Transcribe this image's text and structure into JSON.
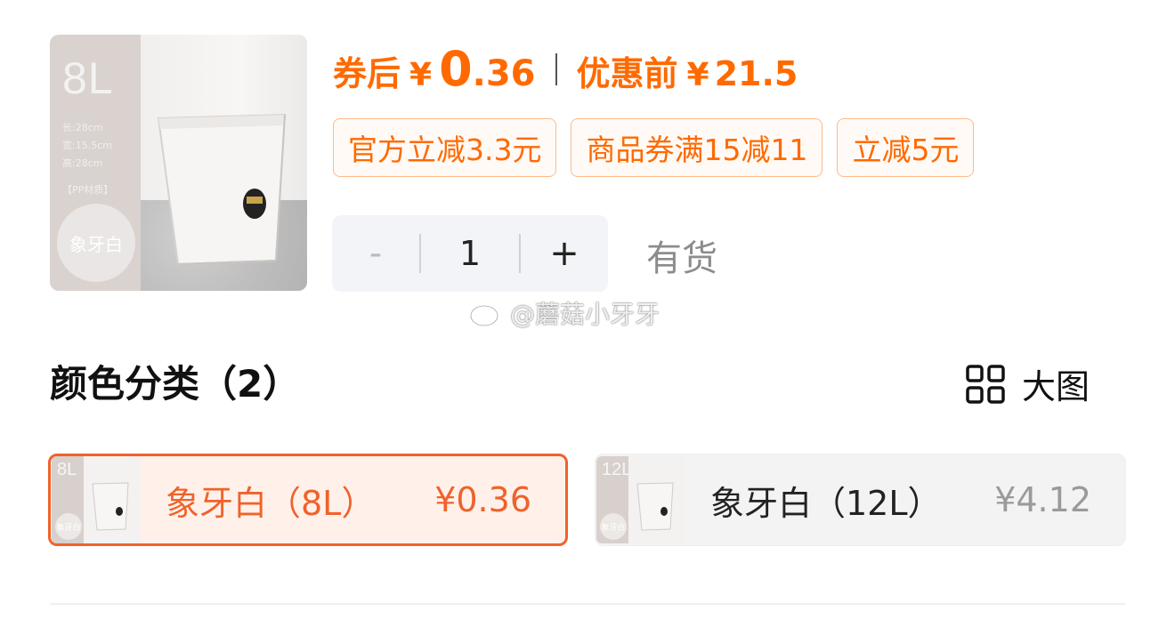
{
  "product": {
    "image_alt": "象牙白 8L 垃圾桶",
    "image_size": "8L",
    "image_specs": [
      "长:28cm",
      "宽:15.5cm",
      "高:28cm",
      "【PP材质】"
    ],
    "image_color_label": "象牙白"
  },
  "price": {
    "after_coupon_label": "券后",
    "after_coupon_currency": "¥",
    "after_coupon_int": "0",
    "after_coupon_dec": ".36",
    "before_label": "优惠前",
    "before_currency": "¥",
    "before_value": "21.5",
    "accent_color": "#ff6a00"
  },
  "coupons": [
    {
      "label": "官方立减3.3元"
    },
    {
      "label": "商品券满15减11"
    },
    {
      "label": "立减5元"
    }
  ],
  "stepper": {
    "minus": "-",
    "quantity": "1",
    "plus": "+"
  },
  "stock_status": "有货",
  "watermark": {
    "icon": "weibo-icon",
    "text": "@蘑菇小牙牙"
  },
  "section": {
    "title": "颜色分类（2）",
    "big_view_label": "大图",
    "big_view_icon": "grid-icon"
  },
  "options": [
    {
      "name": "象牙白（8L）",
      "price": "¥0.36",
      "thumb_size": "8L",
      "thumb_color": "象牙白",
      "selected": true
    },
    {
      "name": "象牙白（12L）",
      "price": "¥4.12",
      "thumb_size": "12L",
      "thumb_color": "象牙白",
      "selected": false
    }
  ],
  "colors": {
    "selected_border": "#f0622b",
    "selected_bg": "#fff1ea",
    "unselected_bg": "#f3f3f4"
  }
}
